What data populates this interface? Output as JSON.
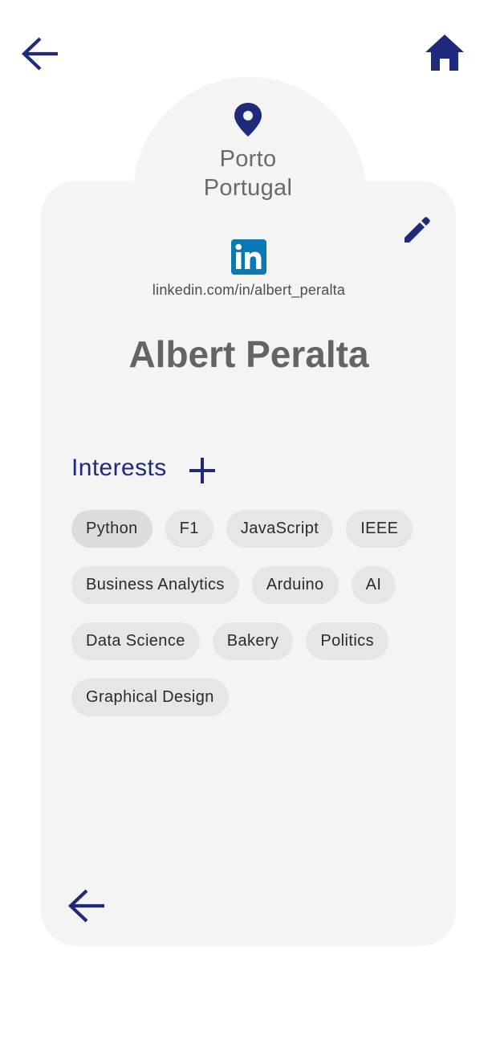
{
  "nav": {
    "back_icon": "arrow-left-icon",
    "home_icon": "home-icon"
  },
  "location": {
    "icon": "location-pin-icon",
    "city": "Porto",
    "country": "Portugal"
  },
  "profile": {
    "linkedin_icon": "linkedin-icon",
    "linkedin_url": "linkedin.com/in/albert_peralta",
    "name": "Albert Peralta",
    "edit_icon": "pencil-icon"
  },
  "interests": {
    "title": "Interests",
    "add_icon": "plus-icon",
    "rows": [
      [
        "Python",
        "F1",
        "JavaScript",
        "IEEE"
      ],
      [
        "Business Analytics",
        "Arduino",
        "AI"
      ],
      [
        "Data Science",
        "Bakery",
        "Politics"
      ],
      [
        "Graphical Design"
      ]
    ]
  },
  "colors": {
    "accent": "#1f2a7a",
    "card": "#f4f4f4",
    "chip": "#e6e6e6",
    "linkedin_blue": "#0a78b5"
  }
}
